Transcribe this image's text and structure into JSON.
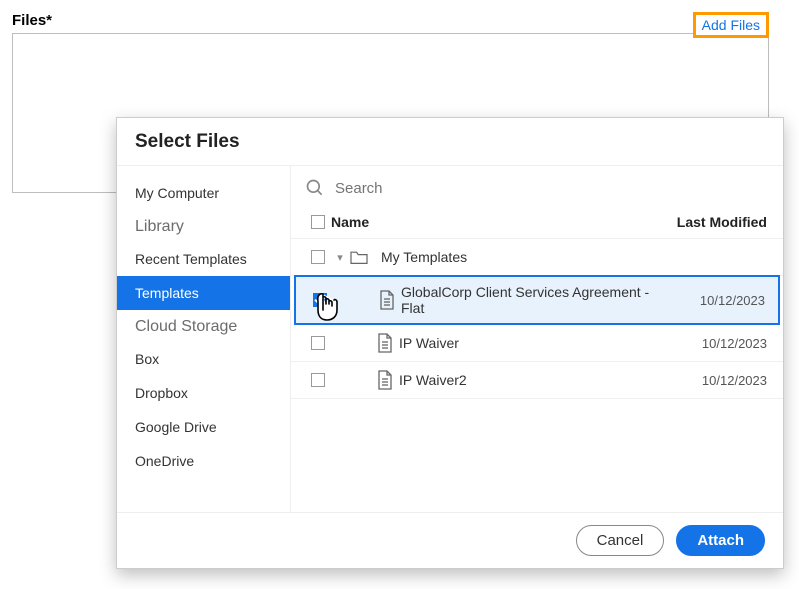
{
  "files": {
    "label": "Files*",
    "addButton": "Add Files"
  },
  "modal": {
    "title": "Select Files",
    "search": {
      "placeholder": "Search"
    },
    "columns": {
      "name": "Name",
      "modified": "Last Modified"
    },
    "sidebar": {
      "items": [
        {
          "kind": "item",
          "label": "My Computer"
        },
        {
          "kind": "heading",
          "label": "Library"
        },
        {
          "kind": "item",
          "label": "Recent Templates"
        },
        {
          "kind": "item",
          "label": "Templates",
          "active": true
        },
        {
          "kind": "heading",
          "label": "Cloud Storage"
        },
        {
          "kind": "item",
          "label": "Box"
        },
        {
          "kind": "item",
          "label": "Dropbox"
        },
        {
          "kind": "item",
          "label": "Google Drive"
        },
        {
          "kind": "item",
          "label": "OneDrive"
        }
      ]
    },
    "folder": {
      "name": "My Templates"
    },
    "files": [
      {
        "name": "GlobalCorp Client Services Agreement - Flat",
        "modified": "10/12/2023",
        "selected": true
      },
      {
        "name": "IP Waiver",
        "modified": "10/12/2023",
        "selected": false
      },
      {
        "name": "IP Waiver2",
        "modified": "10/12/2023",
        "selected": false
      }
    ],
    "buttons": {
      "cancel": "Cancel",
      "attach": "Attach"
    }
  }
}
